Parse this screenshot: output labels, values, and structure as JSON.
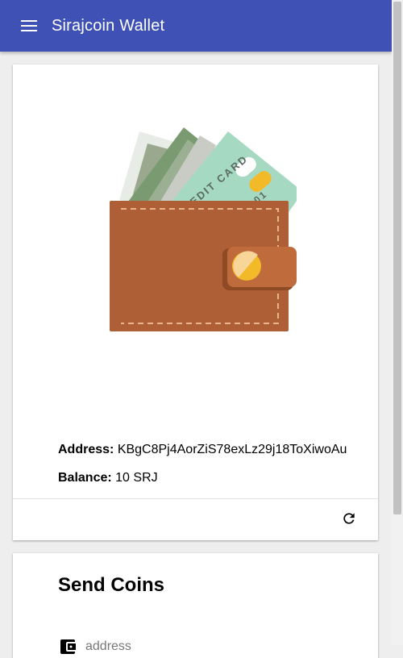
{
  "app": {
    "title": "Sirajcoin Wallet"
  },
  "icons": {
    "menu": "menu-icon",
    "refresh": "refresh-icon",
    "wallet": "wallet-illustration",
    "account": "wallet-field-icon"
  },
  "colors": {
    "primary": "#3f51b5",
    "wallet_brown": "#b5643a",
    "card_green": "#a5d9c2"
  },
  "wallet": {
    "card_text": "CREDIT CARD",
    "card_number": "0001",
    "address_label": "Address:",
    "address": "KBgC8Pj4AorZiS78exLz29j18ToXiwoAu",
    "balance_label": "Balance:",
    "balance": "10 SRJ"
  },
  "send": {
    "title": "Send Coins",
    "address_placeholder": "address"
  }
}
